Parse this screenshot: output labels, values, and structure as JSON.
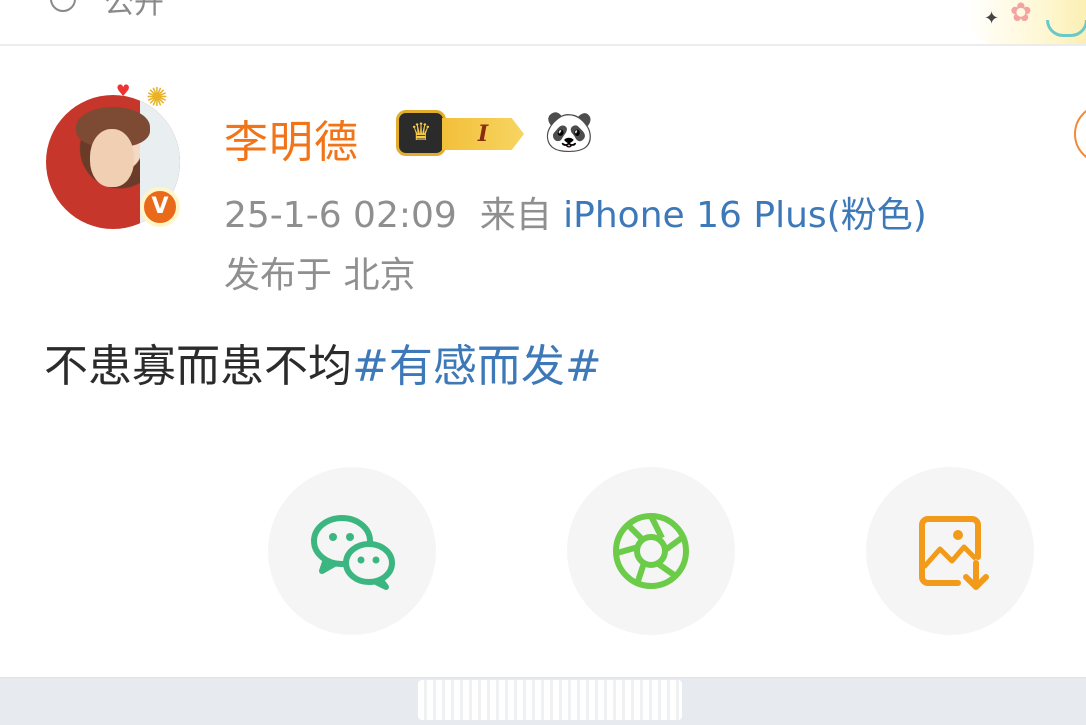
{
  "top_bar": {
    "label": "公开"
  },
  "post": {
    "author": {
      "name": "李明德",
      "level_badge": "I",
      "verified_badge": "V",
      "emoji": "🐼"
    },
    "meta": {
      "timestamp": "25-1-6 02:09",
      "from_label": "来自",
      "source": "iPhone 16 Plus(粉色)",
      "location": "发布于 北京"
    },
    "content": {
      "text": "不患寡而患不均",
      "hashtag": "#有感而发#"
    }
  },
  "share": {
    "colors": {
      "wechat": "#3cb680",
      "moments": "#6ccc4a",
      "save": "#f29a1a"
    }
  }
}
